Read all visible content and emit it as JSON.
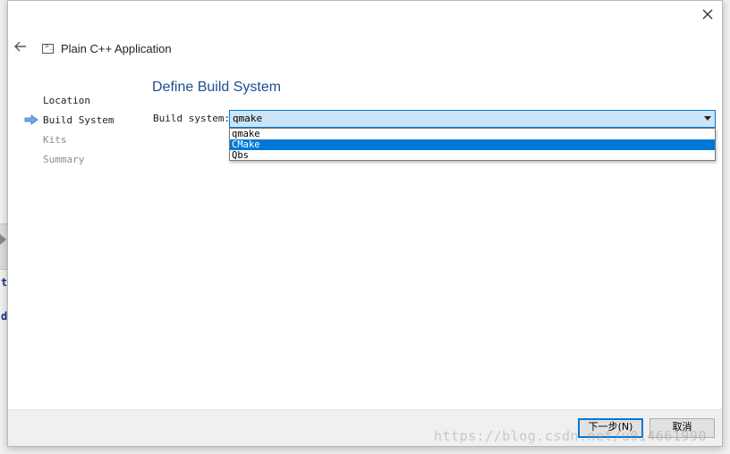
{
  "window": {
    "title": "Plain C++ Application",
    "close_icon": "close-icon",
    "back_icon": "back-arrow-icon",
    "title_icon": "terminal-icon"
  },
  "steps": [
    {
      "label": "Location",
      "state": "done"
    },
    {
      "label": "Build System",
      "state": "current"
    },
    {
      "label": "Kits",
      "state": "pending"
    },
    {
      "label": "Summary",
      "state": "pending"
    }
  ],
  "page": {
    "heading": "Define Build System",
    "field_label": "Build system:",
    "selected_value": "qmake",
    "options": [
      "qmake",
      "CMake",
      "Qbs"
    ],
    "highlighted_option": "CMake"
  },
  "footer": {
    "next_label": "下一步(N)",
    "cancel_label": "取消"
  },
  "watermark": "https://blog.csdn.net/u014661990",
  "colors": {
    "accent": "#0078d7",
    "heading": "#1d4e8f",
    "combo_background": "#cce4f7"
  }
}
